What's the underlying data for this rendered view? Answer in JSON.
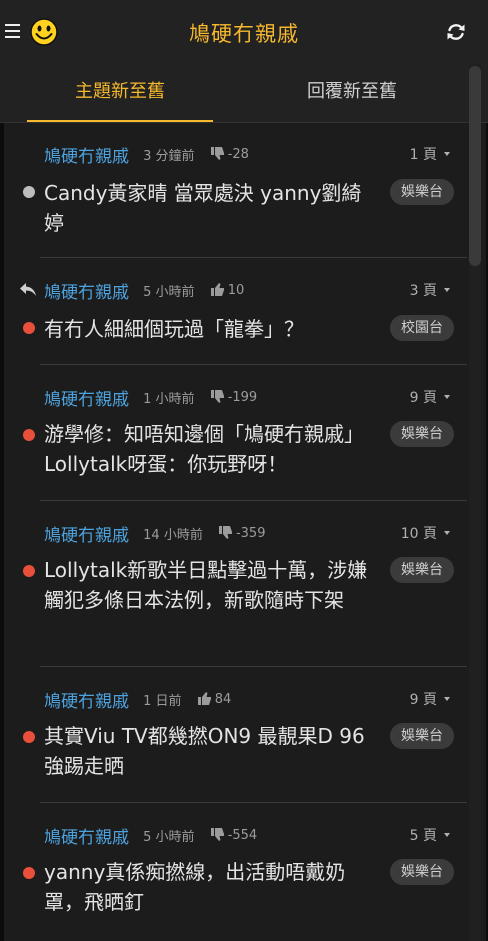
{
  "app": {
    "title": "鳩硬冇親戚"
  },
  "tabs": {
    "newest_topics": "主題新至舊",
    "newest_replies": "回覆新至舊"
  },
  "threads": [
    {
      "author": "鳩硬冇親戚",
      "time": "3 分鐘前",
      "score_icon": "thumbs-down-icon",
      "score": "-28",
      "pages": "1 頁",
      "read_state": "read",
      "title": "Candy黃家晴 當眾處決 yanny劉綺婷",
      "board": "娛樂台"
    },
    {
      "author": "鳩硬冇親戚",
      "time": "5 小時前",
      "score_icon": "thumbs-up-icon",
      "score": "10",
      "pages": "3 頁",
      "read_state": "unread",
      "replied": true,
      "title": "有冇人細細個玩過「龍拳」？",
      "board": "校園台"
    },
    {
      "author": "鳩硬冇親戚",
      "time": "1 小時前",
      "score_icon": "thumbs-down-icon",
      "score": "-199",
      "pages": "9 頁",
      "read_state": "unread",
      "title": "游學修：知唔知邊個「鳩硬冇親戚」 Lollytalk呀蛋：你玩野呀！",
      "board": "娛樂台"
    },
    {
      "author": "鳩硬冇親戚",
      "time": "14 小時前",
      "score_icon": "thumbs-down-icon",
      "score": "-359",
      "pages": "10 頁",
      "read_state": "unread",
      "title": "Lollytalk新歌半日點擊過十萬，涉嫌觸犯多條日本法例，新歌隨時下架",
      "board": "娛樂台"
    },
    {
      "author": "鳩硬冇親戚",
      "time": "1 日前",
      "score_icon": "thumbs-up-icon",
      "score": "84",
      "pages": "9 頁",
      "read_state": "unread",
      "title": "其實Viu TV都幾撚ON9 最靚果D 96強踢走晒",
      "board": "娛樂台"
    },
    {
      "author": "鳩硬冇親戚",
      "time": "5 小時前",
      "score_icon": "thumbs-down-icon",
      "score": "-554",
      "pages": "5 頁",
      "read_state": "unread",
      "title": "yanny真係痴撚線，出活動唔戴奶罩，飛晒釘",
      "board": "娛樂台"
    }
  ],
  "colors": {
    "accent": "#f5b82e",
    "author": "#4da3df",
    "unread_dot": "#e8503c",
    "read_dot": "#bdbdbd",
    "background": "#1c1c1c"
  }
}
